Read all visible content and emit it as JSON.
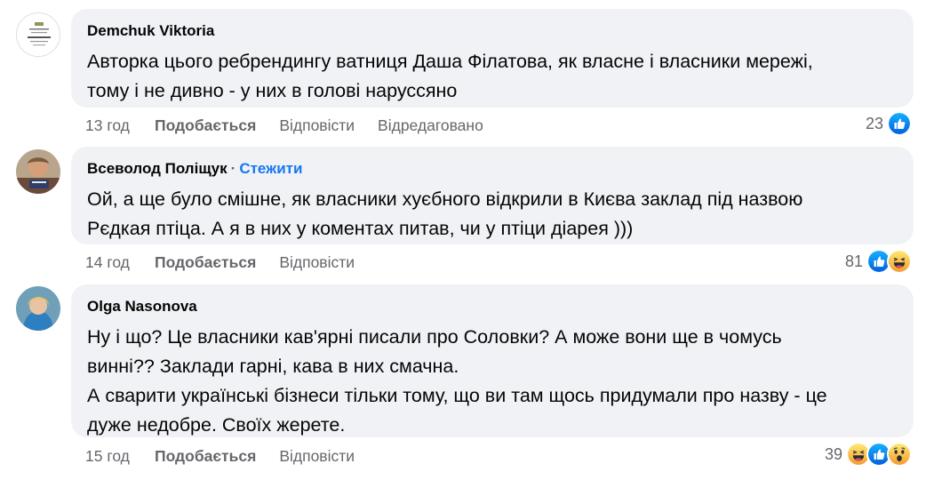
{
  "comments": [
    {
      "author": "Demchuk Viktoria",
      "follow": "",
      "lines": [
        "Авторка цього ребрендингу ватниця Даша Філатова, як власне і власники мережі,",
        "тому і не дивно - у них в голові наруссяно"
      ],
      "time": "13 год",
      "like_label": "Подобається",
      "reply_label": "Відповісти",
      "edited_label": "Відредаговано",
      "reaction_count": "23",
      "reactions": [
        "like-icon"
      ]
    },
    {
      "author": "Всеволод Поліщук",
      "separator": "·",
      "follow": "Стежити",
      "lines": [
        "Ой, а ще було смішне, як власники хуєбного відкрили в Києва заклад під назвою",
        "Рєдкая птіца. А я в них у коментах питав, чи у птіци діарея )))"
      ],
      "time": "14 год",
      "like_label": "Подобається",
      "reply_label": "Відповісти",
      "reaction_count": "81",
      "reactions": [
        "like-icon",
        "haha-icon"
      ]
    },
    {
      "author": "Olga Nasonova",
      "follow": "",
      "lines": [
        "Ну і що? Це власники кав'ярні писали про Соловки? А може вони ще в чомусь",
        "винні?? Заклади гарні, кава в них смачна.",
        "А сварити українські бізнеси тільки тому, що ви там щось придумали про назву - це",
        "дуже недобре. Своїх жерете."
      ],
      "time": "15 год",
      "like_label": "Подобається",
      "reply_label": "Відповісти",
      "reaction_count": "39",
      "reactions": [
        "haha-icon",
        "like-icon",
        "wow-icon"
      ]
    }
  ],
  "colors": {
    "bubble": "#f0f2f5",
    "meta": "#65676b",
    "link": "#1877f2",
    "like": "#1877f2",
    "emoji_yellow": "#f7b125"
  }
}
